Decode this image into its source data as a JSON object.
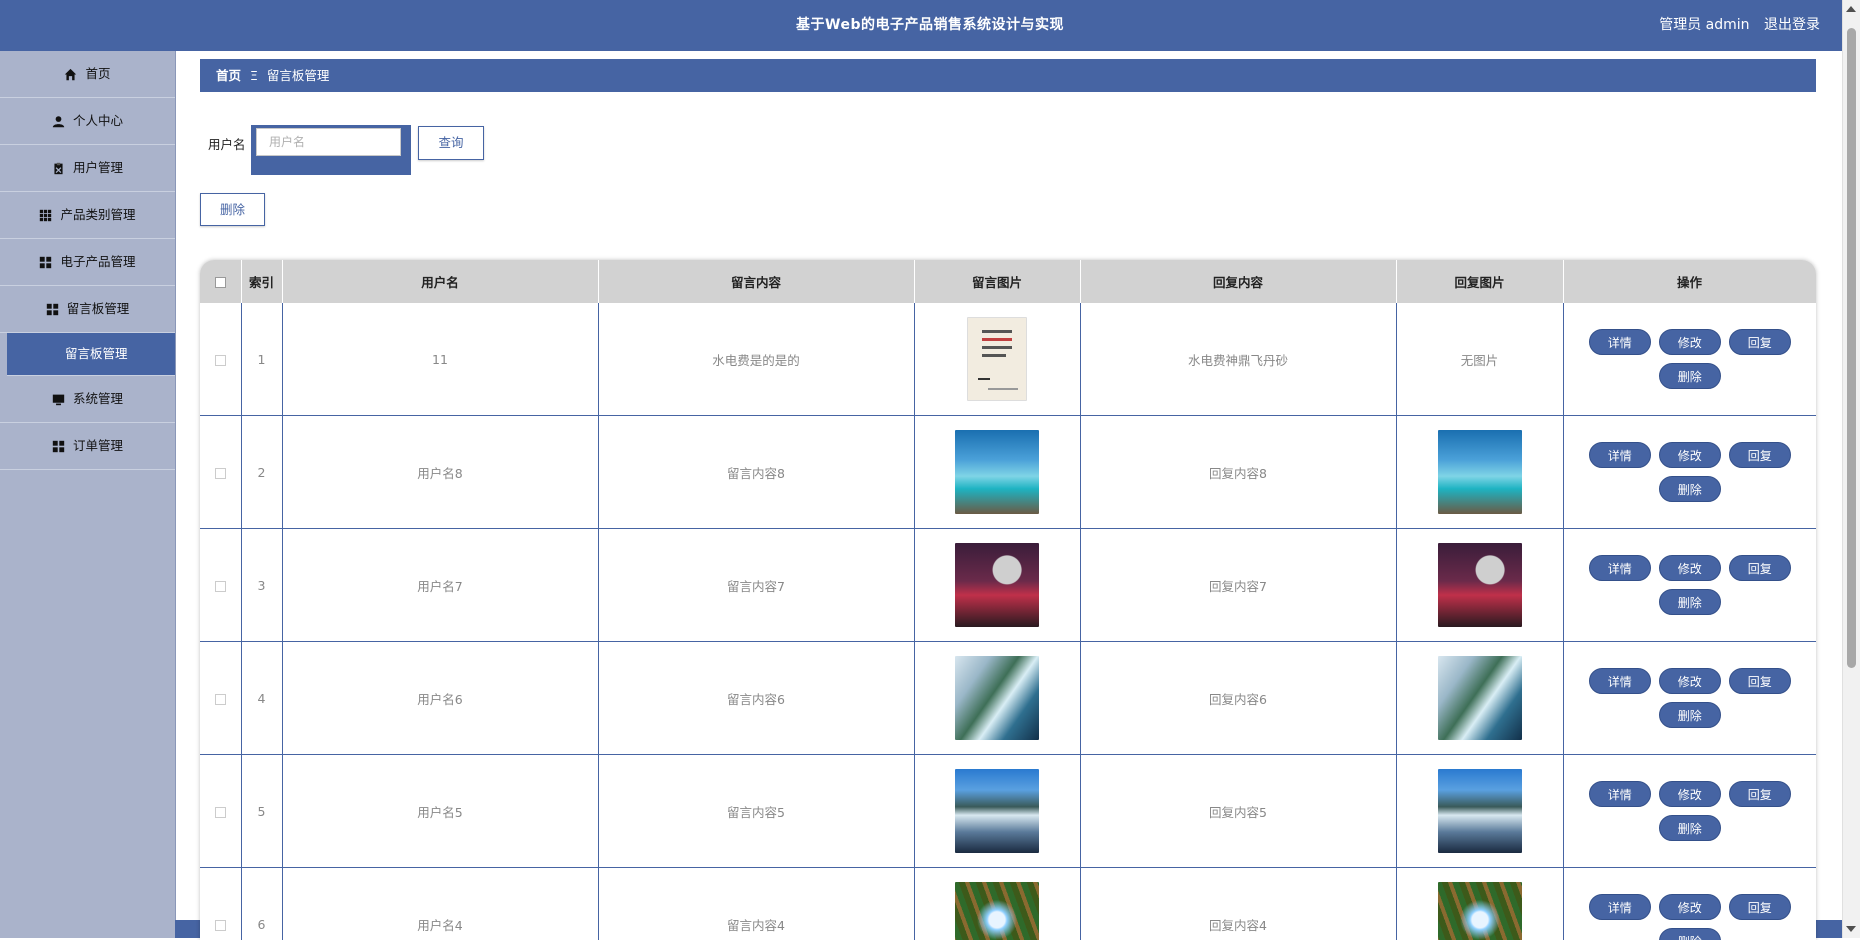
{
  "header": {
    "title": "基于Web的电子产品销售系统设计与实现",
    "user_label": "管理员 admin",
    "logout_label": "退出登录"
  },
  "sidebar": {
    "items": [
      {
        "label": "首页",
        "icon": "home-icon"
      },
      {
        "label": "个人中心",
        "icon": "person-icon"
      },
      {
        "label": "用户管理",
        "icon": "clipboard-icon"
      },
      {
        "label": "产品类别管理",
        "icon": "grid-icon"
      },
      {
        "label": "电子产品管理",
        "icon": "apps-icon"
      },
      {
        "label": "留言板管理",
        "icon": "apps-icon"
      },
      {
        "label": "留言板管理",
        "icon": "",
        "active": true
      },
      {
        "label": "系统管理",
        "icon": "monitor-icon"
      },
      {
        "label": "订单管理",
        "icon": "apps-icon"
      }
    ]
  },
  "breadcrumb": {
    "home": "首页",
    "separator": "Ξ",
    "current": "留言板管理"
  },
  "search": {
    "label": "用户名",
    "placeholder": "用户名",
    "value": "",
    "query_button": "查询"
  },
  "toolbar": {
    "delete_label": "删除"
  },
  "table": {
    "columns": [
      "",
      "索引",
      "用户名",
      "留言内容",
      "留言图片",
      "回复内容",
      "回复图片",
      "操作"
    ],
    "rows": [
      {
        "index": "1",
        "username": "11",
        "content": "水电费是的是的",
        "image": "book",
        "reply": "水电费神鼎飞丹砂",
        "reply_image": "",
        "reply_image_text": "无图片"
      },
      {
        "index": "2",
        "username": "用户名8",
        "content": "留言内容8",
        "image": "beach",
        "reply": "回复内容8",
        "reply_image": "beach",
        "reply_image_text": ""
      },
      {
        "index": "3",
        "username": "用户名7",
        "content": "留言内容7",
        "image": "moon",
        "reply": "回复内容7",
        "reply_image": "moon",
        "reply_image_text": ""
      },
      {
        "index": "4",
        "username": "用户名6",
        "content": "留言内容6",
        "image": "fall1",
        "reply": "回复内容6",
        "reply_image": "fall1",
        "reply_image_text": ""
      },
      {
        "index": "5",
        "username": "用户名5",
        "content": "留言内容5",
        "image": "fall2",
        "reply": "回复内容5",
        "reply_image": "fall2",
        "reply_image_text": ""
      },
      {
        "index": "6",
        "username": "用户名4",
        "content": "留言内容4",
        "image": "forest",
        "reply": "回复内容4",
        "reply_image": "forest",
        "reply_image_text": ""
      }
    ],
    "actions": [
      "详情",
      "修改",
      "回复",
      "删除"
    ]
  },
  "colors": {
    "primary": "#4664a3",
    "sidebar_bg": "#aab3cb",
    "header_row": "#d2d2d2"
  }
}
